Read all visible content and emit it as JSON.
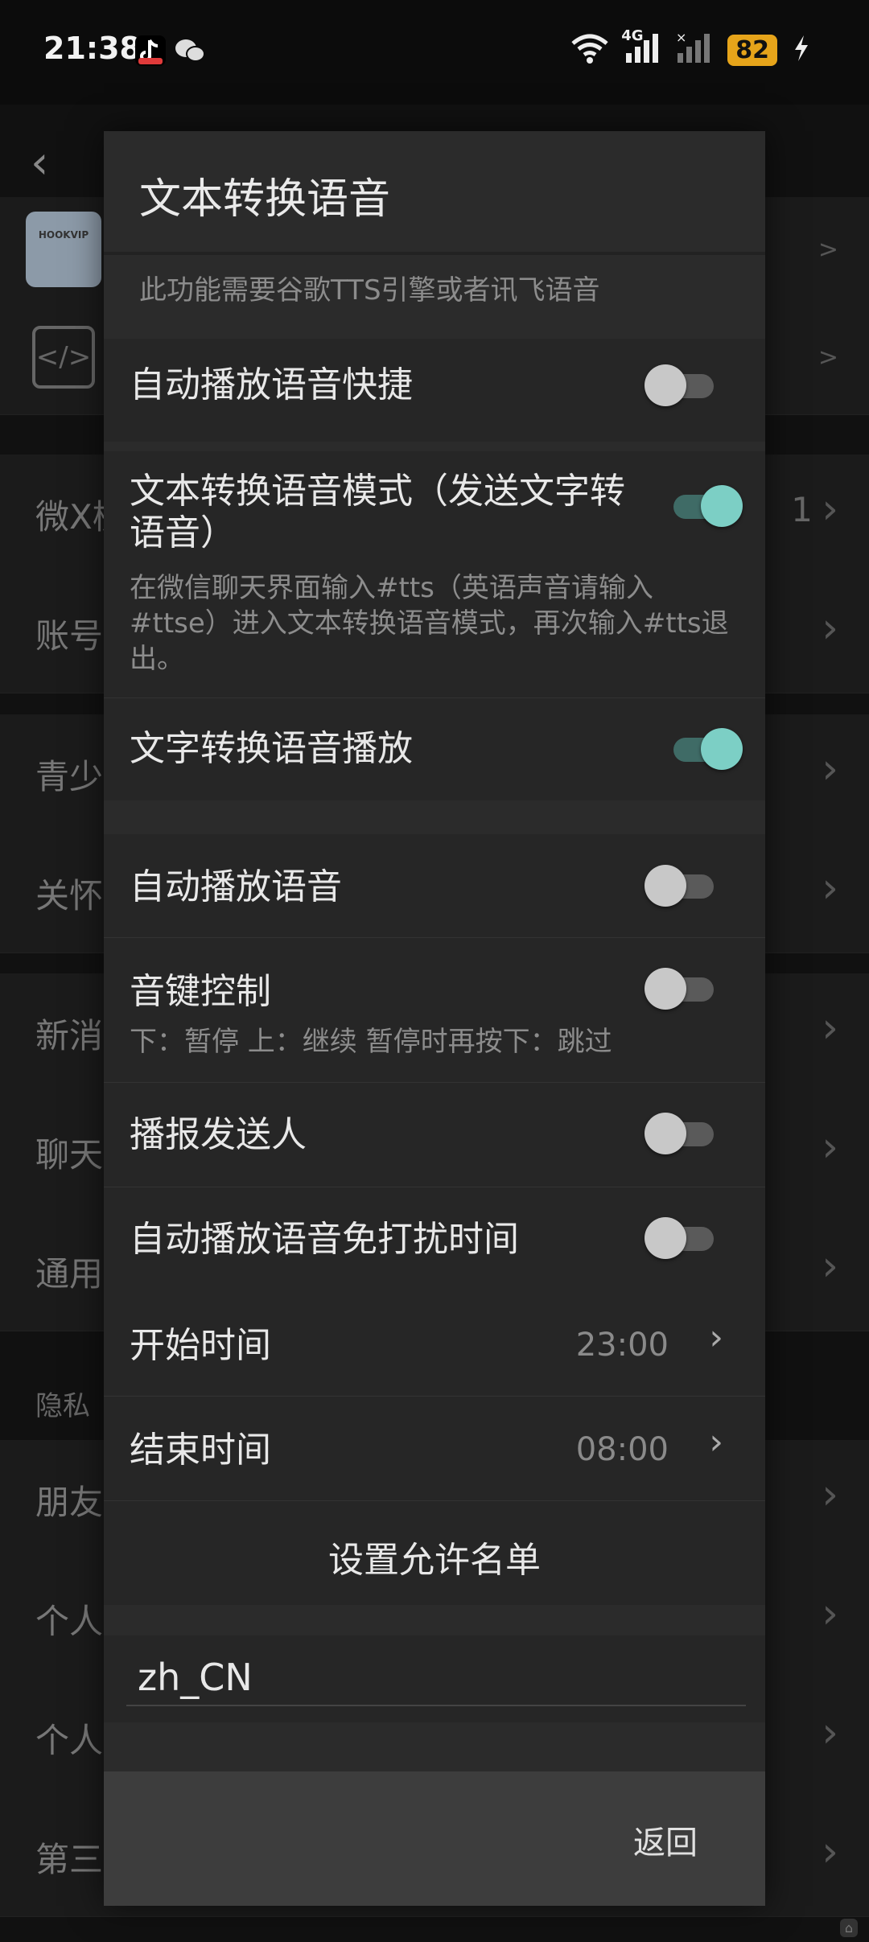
{
  "status_bar": {
    "time": "21:38",
    "network": "4G",
    "battery": "82",
    "icons": [
      "tiktok-icon",
      "wechat-icon",
      "wifi-icon",
      "signal-icon",
      "signal-x-icon",
      "charging-icon"
    ]
  },
  "background_page": {
    "rows": [
      {
        "label": "微X模",
        "suffix": "1"
      },
      {
        "label": "账号"
      },
      {
        "label": "青少"
      },
      {
        "label": "关怀"
      },
      {
        "label": "新消"
      },
      {
        "label": "聊天"
      },
      {
        "label": "通用"
      },
      {
        "label": "朋友"
      },
      {
        "label": "个人"
      },
      {
        "label": "个人"
      },
      {
        "label": "第三"
      }
    ],
    "section_privacy": "隐私",
    "thumb_text": "HOOKVIP"
  },
  "dialog": {
    "title": "文本转换语音",
    "hint": "此功能需要谷歌TTS引擎或者讯飞语音",
    "items": {
      "auto_play_shortcut": {
        "label": "自动播放语音快捷",
        "on": false
      },
      "tts_mode": {
        "label": "文本转换语音模式（发送文字转语音）",
        "desc": "在微信聊天界面输入#tts（英语声音请输入#ttse）进入文本转换语音模式，再次输入#tts退出。",
        "on": true
      },
      "text_to_speech_play": {
        "label": "文字转换语音播放",
        "on": true
      },
      "auto_play_voice": {
        "label": "自动播放语音",
        "on": false
      },
      "volume_key_control": {
        "label": "音键控制",
        "desc": "下：暂停 上：继续 暂停时再按下：跳过",
        "on": false
      },
      "announce_sender": {
        "label": "播报发送人",
        "on": false
      },
      "dnd_time": {
        "label": "自动播放语音免打扰时间",
        "on": false
      },
      "start_time": {
        "label": "开始时间",
        "value": "23:00"
      },
      "end_time": {
        "label": "结束时间",
        "value": "08:00"
      },
      "allow_list": {
        "label": "设置允许名单"
      }
    },
    "locale_input": {
      "value": "zh_CN"
    },
    "back_button": "返回"
  },
  "colors": {
    "accent": "#7ccfc5",
    "battery": "#e6a41a"
  }
}
